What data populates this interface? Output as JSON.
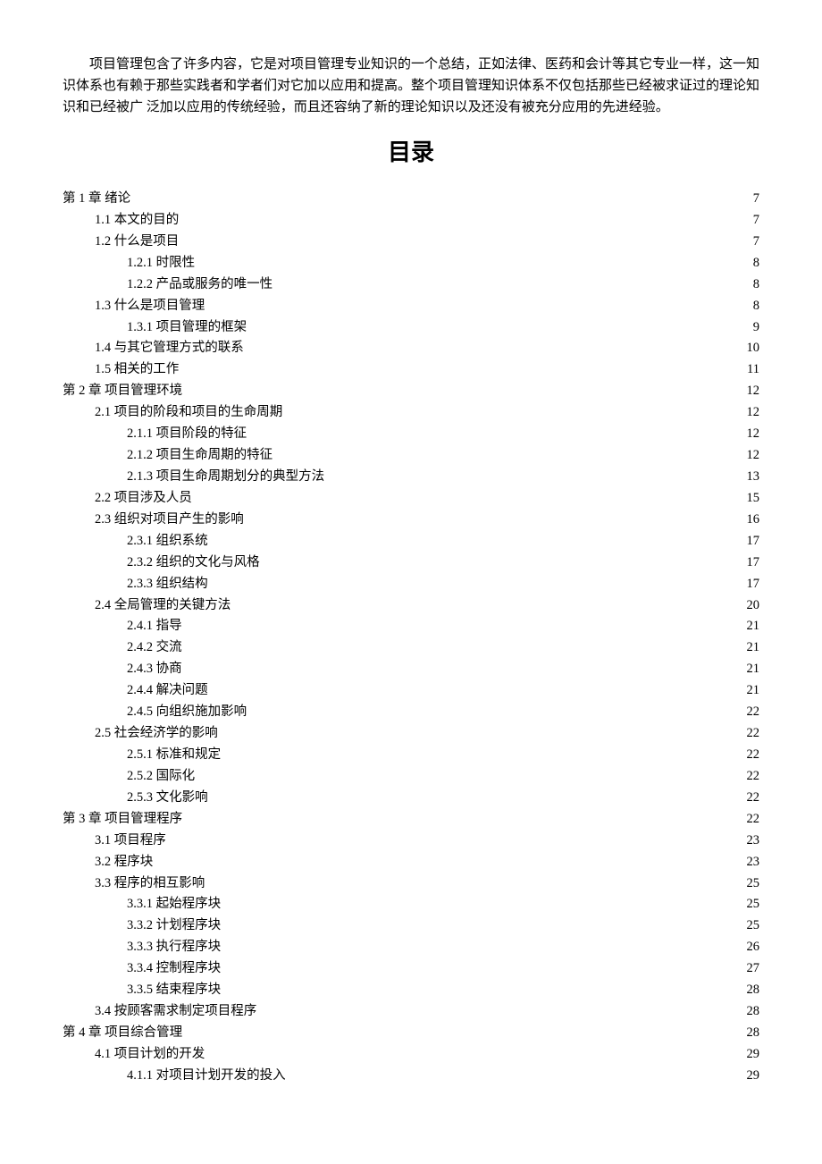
{
  "intro": "项目管理包含了许多内容，它是对项目管理专业知识的一个总结，正如法律、医药和会计等其它专业一样，这一知识体系也有赖于那些实践者和学者们对它加以应用和提高。整个项目管理知识体系不仅包括那些已经被求证过的理论知识和已经被广 泛加以应用的传统经验，而且还容纳了新的理论知识以及还没有被充分应用的先进经验。",
  "toc_title": "目录",
  "toc": [
    {
      "level": 0,
      "label": "第 1 章 绪论",
      "page": "7"
    },
    {
      "level": 1,
      "label": "1.1 本文的目的",
      "page": "7"
    },
    {
      "level": 1,
      "label": "1.2 什么是项目",
      "page": "7"
    },
    {
      "level": 2,
      "label": "1.2.1 时限性",
      "page": "8"
    },
    {
      "level": 2,
      "label": "1.2.2 产品或服务的唯一性",
      "page": "8"
    },
    {
      "level": 1,
      "label": "1.3 什么是项目管理",
      "page": "8"
    },
    {
      "level": 2,
      "label": "1.3.1 项目管理的框架",
      "page": "9"
    },
    {
      "level": 1,
      "label": "1.4 与其它管理方式的联系",
      "page": "10"
    },
    {
      "level": 1,
      "label": "1.5 相关的工作",
      "page": "11"
    },
    {
      "level": 0,
      "label": "第 2 章 项目管理环境",
      "page": "12"
    },
    {
      "level": 1,
      "label": "2.1 项目的阶段和项目的生命周期",
      "page": "12"
    },
    {
      "level": 2,
      "label": "2.1.1 项目阶段的特征",
      "page": "12"
    },
    {
      "level": 2,
      "label": "2.1.2 项目生命周期的特征",
      "page": "12"
    },
    {
      "level": 2,
      "label": "2.1.3 项目生命周期划分的典型方法",
      "page": "13"
    },
    {
      "level": 1,
      "label": "2.2 项目涉及人员",
      "page": "15"
    },
    {
      "level": 1,
      "label": "2.3 组织对项目产生的影响",
      "page": "16"
    },
    {
      "level": 2,
      "label": "2.3.1 组织系统",
      "page": "17"
    },
    {
      "level": 2,
      "label": "2.3.2 组织的文化与风格",
      "page": "17"
    },
    {
      "level": 2,
      "label": "2.3.3 组织结构",
      "page": "17"
    },
    {
      "level": 1,
      "label": "2.4 全局管理的关键方法",
      "page": "20"
    },
    {
      "level": 2,
      "label": "2.4.1 指导",
      "page": "21"
    },
    {
      "level": 2,
      "label": "2.4.2 交流",
      "page": "21"
    },
    {
      "level": 2,
      "label": "2.4.3 协商",
      "page": "21"
    },
    {
      "level": 2,
      "label": "2.4.4 解决问题",
      "page": "21"
    },
    {
      "level": 2,
      "label": "2.4.5 向组织施加影响",
      "page": "22"
    },
    {
      "level": 1,
      "label": "2.5 社会经济学的影响",
      "page": "22"
    },
    {
      "level": 2,
      "label": "2.5.1 标准和规定",
      "page": "22"
    },
    {
      "level": 2,
      "label": "2.5.2 国际化",
      "page": "22"
    },
    {
      "level": 2,
      "label": "2.5.3 文化影响",
      "page": "22"
    },
    {
      "level": 0,
      "label": "第 3 章 项目管理程序",
      "page": "22"
    },
    {
      "level": 1,
      "label": "3.1 项目程序",
      "page": "23"
    },
    {
      "level": 1,
      "label": "3.2 程序块",
      "page": "23"
    },
    {
      "level": 1,
      "label": "3.3 程序的相互影响",
      "page": "25"
    },
    {
      "level": 2,
      "label": "3.3.1 起始程序块",
      "page": "25"
    },
    {
      "level": 2,
      "label": "3.3.2 计划程序块",
      "page": "25"
    },
    {
      "level": 2,
      "label": "3.3.3 执行程序块",
      "page": "26"
    },
    {
      "level": 2,
      "label": "3.3.4 控制程序块",
      "page": "27"
    },
    {
      "level": 2,
      "label": "3.3.5 结束程序块",
      "page": "28"
    },
    {
      "level": 1,
      "label": "3.4 按顾客需求制定项目程序",
      "page": "28"
    },
    {
      "level": 0,
      "label": "第 4 章 项目综合管理",
      "page": "28"
    },
    {
      "level": 1,
      "label": "4.1 项目计划的开发",
      "page": "29"
    },
    {
      "level": 2,
      "label": "4.1.1 对项目计划开发的投入",
      "page": "29"
    }
  ]
}
